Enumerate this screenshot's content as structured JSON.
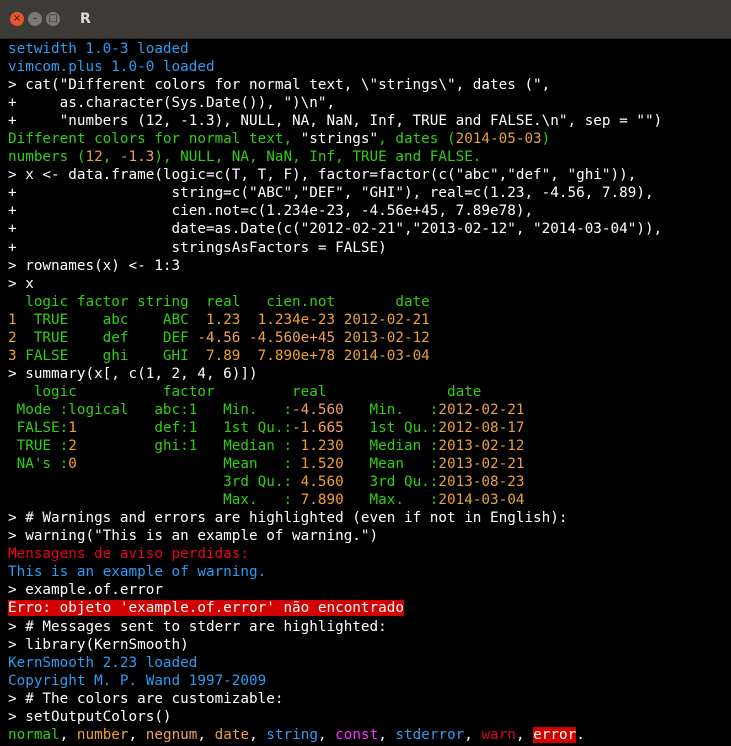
{
  "window": {
    "title": "R",
    "close_glyph": "×",
    "min_glyph": "–",
    "max_glyph": "□"
  },
  "colors": {
    "normal": "#2fd10e",
    "number": "#f0a22a",
    "negnum": "#f2a060",
    "date": "#e6a23c",
    "string": "#2a9df4",
    "const": "#ff30ff",
    "stderror": "#2a9df4",
    "warn": "#e8002a",
    "error_bg": "#d30000"
  },
  "lines": [
    {
      "segs": [
        {
          "t": "setwidth 1.0-3 loaded",
          "c": "b"
        }
      ]
    },
    {
      "segs": [
        {
          "t": "vimcom.plus 1.0-0 loaded",
          "c": "b"
        }
      ]
    },
    {
      "segs": [
        {
          "t": "> cat(\"Different colors for normal text, \\\"strings\\\", dates (\",",
          "c": "w"
        }
      ]
    },
    {
      "segs": [
        {
          "t": "+     as.character(Sys.Date()), \")\\n\",",
          "c": "w"
        }
      ]
    },
    {
      "segs": [
        {
          "t": "+     \"numbers (12, -1.3), NULL, NA, NaN, Inf, TRUE and FALSE.\\n\", sep = \"\")",
          "c": "w"
        }
      ]
    },
    {
      "segs": [
        {
          "t": "Different colors for normal text, ",
          "c": "g"
        },
        {
          "t": "\"strings\"",
          "c": "w"
        },
        {
          "t": ", dates (",
          "c": "g"
        },
        {
          "t": "2014-05-03",
          "c": "dy"
        },
        {
          "t": ")",
          "c": "g"
        }
      ]
    },
    {
      "segs": [
        {
          "t": "numbers (",
          "c": "g"
        },
        {
          "t": "12",
          "c": "y"
        },
        {
          "t": ", ",
          "c": "g"
        },
        {
          "t": "-1.3",
          "c": "n"
        },
        {
          "t": "), NULL, NA, NaN, Inf, TRUE and FALSE.",
          "c": "g"
        }
      ]
    },
    {
      "segs": [
        {
          "t": "> x <- data.frame(logic=c(T, T, F), factor=factor(c(\"abc\",\"def\", \"ghi\")),",
          "c": "w"
        }
      ]
    },
    {
      "segs": [
        {
          "t": "+                  string=c(\"ABC\",\"DEF\", \"GHI\"), real=c(1.23, -4.56, 7.89),",
          "c": "w"
        }
      ]
    },
    {
      "segs": [
        {
          "t": "+                  cien.not=c(1.234e-23, -4.56e+45, 7.89e78),",
          "c": "w"
        }
      ]
    },
    {
      "segs": [
        {
          "t": "+                  date=as.Date(c(\"2012-02-21\",\"2013-02-12\", \"2014-03-04\")),",
          "c": "w"
        }
      ]
    },
    {
      "segs": [
        {
          "t": "+                  stringsAsFactors = FALSE)",
          "c": "w"
        }
      ]
    },
    {
      "segs": [
        {
          "t": "> rownames(x) <- 1:3",
          "c": "w"
        }
      ]
    },
    {
      "segs": [
        {
          "t": "> x",
          "c": "w"
        }
      ]
    },
    {
      "segs": [
        {
          "t": "  logic factor string  real   cien.not       date",
          "c": "g"
        }
      ]
    },
    {
      "segs": [
        {
          "t": "1",
          "c": "y"
        },
        {
          "t": "  TRUE    abc    ABC  ",
          "c": "g"
        },
        {
          "t": "1.23",
          "c": "y"
        },
        {
          "t": "  ",
          "c": "g"
        },
        {
          "t": "1.234e-23",
          "c": "y"
        },
        {
          "t": " ",
          "c": "g"
        },
        {
          "t": "2012-02-21",
          "c": "dy"
        }
      ]
    },
    {
      "segs": [
        {
          "t": "2",
          "c": "y"
        },
        {
          "t": "  TRUE    def    DEF ",
          "c": "g"
        },
        {
          "t": "-4.56",
          "c": "n"
        },
        {
          "t": " ",
          "c": "g"
        },
        {
          "t": "-4.560e+45",
          "c": "n"
        },
        {
          "t": " ",
          "c": "g"
        },
        {
          "t": "2013-02-12",
          "c": "dy"
        }
      ]
    },
    {
      "segs": [
        {
          "t": "3",
          "c": "y"
        },
        {
          "t": " FALSE    ghi    GHI  ",
          "c": "g"
        },
        {
          "t": "7.89",
          "c": "y"
        },
        {
          "t": "  ",
          "c": "g"
        },
        {
          "t": "7.890e+78",
          "c": "y"
        },
        {
          "t": " ",
          "c": "g"
        },
        {
          "t": "2014-03-04",
          "c": "dy"
        }
      ]
    },
    {
      "segs": [
        {
          "t": "> summary(x[, c(1, 2, 4, 6)])",
          "c": "w"
        }
      ]
    },
    {
      "segs": [
        {
          "t": "   logic          factor         real              date",
          "c": "g"
        }
      ]
    },
    {
      "segs": [
        {
          "t": " Mode :logical   abc:1   Min.   :",
          "c": "g"
        },
        {
          "t": "-4.560",
          "c": "n"
        },
        {
          "t": "   Min.   :",
          "c": "g"
        },
        {
          "t": "2012-02-21",
          "c": "dy"
        }
      ]
    },
    {
      "segs": [
        {
          "t": " FALSE:",
          "c": "g"
        },
        {
          "t": "1",
          "c": "y"
        },
        {
          "t": "         def:1   1st Qu.:",
          "c": "g"
        },
        {
          "t": "-1.665",
          "c": "n"
        },
        {
          "t": "   1st Qu.:",
          "c": "g"
        },
        {
          "t": "2012-08-17",
          "c": "dy"
        }
      ]
    },
    {
      "segs": [
        {
          "t": " TRUE :",
          "c": "g"
        },
        {
          "t": "2",
          "c": "y"
        },
        {
          "t": "         ghi:1   Median : ",
          "c": "g"
        },
        {
          "t": "1.230",
          "c": "y"
        },
        {
          "t": "   Median :",
          "c": "g"
        },
        {
          "t": "2013-02-12",
          "c": "dy"
        }
      ]
    },
    {
      "segs": [
        {
          "t": " NA's :",
          "c": "g"
        },
        {
          "t": "0",
          "c": "y"
        },
        {
          "t": "                 Mean   : ",
          "c": "g"
        },
        {
          "t": "1.520",
          "c": "y"
        },
        {
          "t": "   Mean   :",
          "c": "g"
        },
        {
          "t": "2013-02-21",
          "c": "dy"
        }
      ]
    },
    {
      "segs": [
        {
          "t": "                         3rd Qu.: ",
          "c": "g"
        },
        {
          "t": "4.560",
          "c": "y"
        },
        {
          "t": "   3rd Qu.:",
          "c": "g"
        },
        {
          "t": "2013-08-23",
          "c": "dy"
        }
      ]
    },
    {
      "segs": [
        {
          "t": "                         Max.   : ",
          "c": "g"
        },
        {
          "t": "7.890",
          "c": "y"
        },
        {
          "t": "   Max.   :",
          "c": "g"
        },
        {
          "t": "2014-03-04",
          "c": "dy"
        }
      ]
    },
    {
      "segs": [
        {
          "t": "> # Warnings and errors are highlighted (even if not in English):",
          "c": "w"
        }
      ]
    },
    {
      "segs": [
        {
          "t": "> warning(\"This is an example of warning.\")",
          "c": "w"
        }
      ]
    },
    {
      "segs": [
        {
          "t": "Mensagens de aviso perdidas:",
          "c": "r"
        }
      ]
    },
    {
      "segs": [
        {
          "t": "This is an example of warning.",
          "c": "b"
        }
      ]
    },
    {
      "segs": [
        {
          "t": "> example.of.error",
          "c": "w"
        }
      ]
    },
    {
      "segs": [
        {
          "t": "Erro: objeto 'example.of.error' não encontrado",
          "c": "bgr"
        }
      ]
    },
    {
      "segs": [
        {
          "t": "> # Messages sent to stderr are highlighted:",
          "c": "w"
        }
      ]
    },
    {
      "segs": [
        {
          "t": "> library(KernSmooth)",
          "c": "w"
        }
      ]
    },
    {
      "segs": [
        {
          "t": "KernSmooth 2.23 loaded",
          "c": "b"
        }
      ]
    },
    {
      "segs": [
        {
          "t": "Copyright M. P. Wand 1997-2009",
          "c": "b"
        }
      ]
    },
    {
      "segs": [
        {
          "t": "> # The colors are customizable:",
          "c": "w"
        }
      ]
    },
    {
      "segs": [
        {
          "t": "> setOutputColors()",
          "c": "w"
        }
      ]
    },
    {
      "segs": [
        {
          "t": "normal",
          "c": "g"
        },
        {
          "t": ", ",
          "c": "w"
        },
        {
          "t": "number",
          "c": "y"
        },
        {
          "t": ", ",
          "c": "w"
        },
        {
          "t": "negnum",
          "c": "n"
        },
        {
          "t": ", ",
          "c": "w"
        },
        {
          "t": "date",
          "c": "dy"
        },
        {
          "t": ", ",
          "c": "w"
        },
        {
          "t": "string",
          "c": "b"
        },
        {
          "t": ", ",
          "c": "w"
        },
        {
          "t": "const",
          "c": "m"
        },
        {
          "t": ", ",
          "c": "w"
        },
        {
          "t": "stderror",
          "c": "b"
        },
        {
          "t": ", ",
          "c": "w"
        },
        {
          "t": "warn",
          "c": "r"
        },
        {
          "t": ", ",
          "c": "w"
        },
        {
          "t": "error",
          "c": "bgr"
        },
        {
          "t": ".",
          "c": "w"
        }
      ]
    }
  ]
}
